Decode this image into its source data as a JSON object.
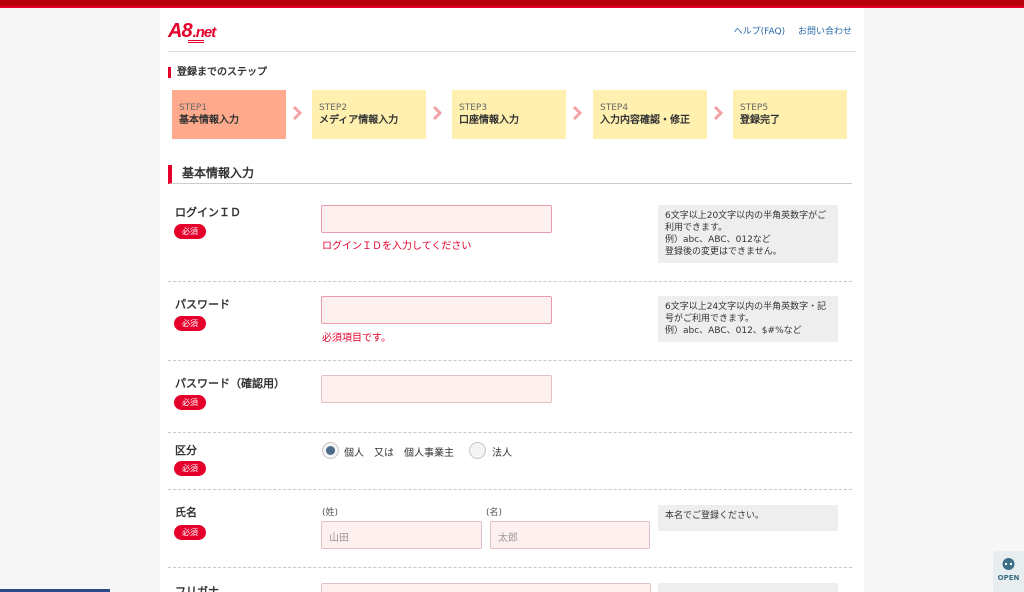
{
  "header": {
    "logo_main": "A8",
    "logo_suffix": ".net",
    "links": [
      "ヘルプ(FAQ)",
      "お問い合わせ"
    ]
  },
  "steps_title": "登録までのステップ",
  "steps": [
    {
      "label": "STEP1",
      "name": "基本情報入力"
    },
    {
      "label": "STEP2",
      "name": "メディア情報入力"
    },
    {
      "label": "STEP3",
      "name": "口座情報入力"
    },
    {
      "label": "STEP4",
      "name": "入力内容確認・修正"
    },
    {
      "label": "STEP5",
      "name": "登録完了"
    }
  ],
  "active_step": "STEP1",
  "section_title": "基本情報入力",
  "required_badge": "必須",
  "fields": {
    "login_id": {
      "label": "ログインＩＤ",
      "value": "",
      "error": "ログインＩＤを入力してください",
      "help": [
        "6文字以上20文字以内の半角英数字がご",
        "利用できます。",
        "例）abc、ABC、012など",
        "登録後の変更はできません。"
      ]
    },
    "password": {
      "label": "パスワード",
      "value": "",
      "error": "必須項目です。",
      "help": [
        "6文字以上24文字以内の半角英数字・記",
        "号がご利用できます。",
        "例）abc、ABC、012、$#%など"
      ]
    },
    "password_confirm": {
      "label": "パスワード（確認用）",
      "value": ""
    },
    "category": {
      "label": "区分",
      "options": [
        "個人　又は　個人事業主",
        "法人"
      ],
      "selected": "個人　又は　個人事業主"
    },
    "name": {
      "label": "氏名",
      "last_label": "(姓)",
      "first_label": "(名)",
      "last_placeholder": "山田",
      "first_placeholder": "太郎",
      "help": [
        "本名でご登録ください。"
      ]
    },
    "furigana": {
      "label": "フリガナ"
    }
  },
  "open_button": "OPEN",
  "colors": {
    "brand_red": "#e4002b",
    "step_active": "#ffaa8c",
    "step_inactive": "#fff0b0",
    "input_bg": "#fff0f0",
    "link": "#2b6aa8"
  }
}
